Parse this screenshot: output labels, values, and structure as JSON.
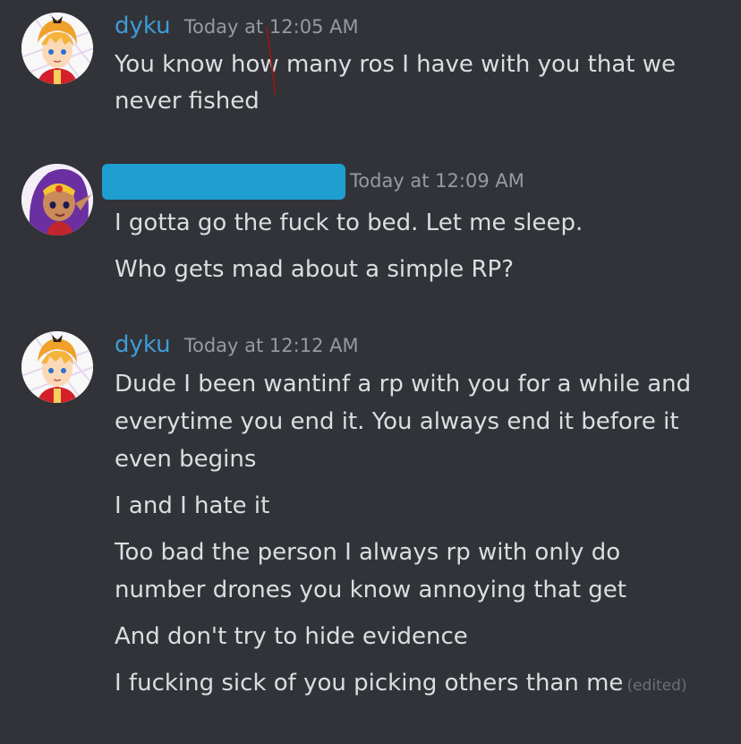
{
  "messages": [
    {
      "username": "dyku",
      "timestamp": "Today at 12:05 AM",
      "lines": [
        "You know how many ros I have with you that we",
        "never fished"
      ]
    },
    {
      "username": "",
      "timestamp": "Today at 12:09 AM",
      "lines": [
        "I gotta go the fuck to bed. Let me sleep.",
        "Who gets mad about a simple RP?"
      ]
    },
    {
      "username": "dyku",
      "timestamp": "Today at 12:12 AM",
      "lines": [
        "Dude I been wantinf a  rp with you for a while and",
        "everytime you end it. You always end it before it",
        "even begins",
        "I and I hate it",
        "Too bad the person I always rp with only do",
        "number drones you know annoying that get",
        "And don't try to hide evidence",
        "I fucking sick of you picking others than me"
      ],
      "edited_label": "(edited)"
    }
  ],
  "colors": {
    "background": "#313338",
    "username": "#3f9bd7",
    "text": "#dbdee1",
    "timestamp": "#949ba4",
    "redaction": "#1e9fd0"
  },
  "icons": {
    "avatar_1": "anime-boy-avatar",
    "avatar_2": "purple-hair-genie-avatar",
    "avatar_3": "anime-boy-avatar"
  }
}
